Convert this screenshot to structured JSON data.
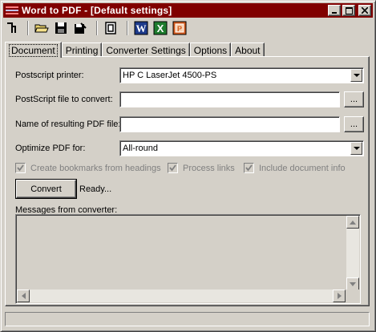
{
  "window": {
    "title": "Word to PDF - [Default settings]",
    "title_bar_color": "#800000",
    "controls": [
      "minimize-icon",
      "maximize-icon",
      "close-icon"
    ]
  },
  "toolbar": {
    "icons": [
      "printer-icon",
      "open-folder-icon",
      "save-icon",
      "save-as-icon",
      "document-icon",
      "word-icon",
      "excel-icon",
      "powerpoint-icon"
    ],
    "word_letter": "W",
    "excel_letter": "X",
    "powerpoint_letter": "P"
  },
  "tabs": [
    {
      "label": "Document",
      "active": true
    },
    {
      "label": "Printing",
      "active": false
    },
    {
      "label": "Converter Settings",
      "active": false
    },
    {
      "label": "Options",
      "active": false
    },
    {
      "label": "About",
      "active": false
    }
  ],
  "form": {
    "printer_label": "Postscript printer:",
    "printer_value": "HP C LaserJet 4500-PS",
    "ps_file_label": "PostScript file to convert:",
    "ps_file_value": "",
    "pdf_file_label": "Name of resulting PDF file:",
    "pdf_file_value": "",
    "browse_label": "...",
    "optimize_label": "Optimize PDF for:",
    "optimize_value": "All-round"
  },
  "checkboxes": [
    {
      "label": "Create bookmarks from headings",
      "checked": true,
      "enabled": false
    },
    {
      "label": "Process links",
      "checked": true,
      "enabled": false
    },
    {
      "label": "Include document info",
      "checked": true,
      "enabled": false
    }
  ],
  "convert": {
    "button_label": "Convert",
    "status": "Ready..."
  },
  "messages": {
    "label": "Messages from converter:",
    "content": ""
  },
  "statusbar": {
    "text": ""
  }
}
